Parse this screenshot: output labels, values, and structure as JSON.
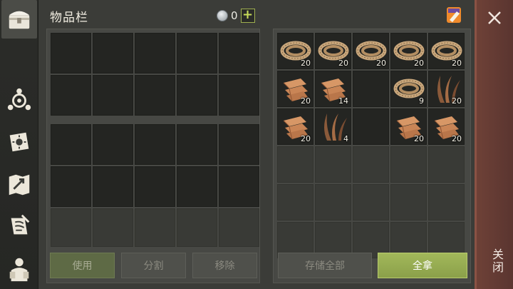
{
  "title": "物品栏",
  "currency": {
    "icon": "silver-coin-icon",
    "count": "0",
    "add_label": "+"
  },
  "sidebar": {
    "items": [
      {
        "name": "backpack",
        "icon": "chest-icon",
        "active": true
      },
      {
        "name": "crafting",
        "icon": "crafting-icon"
      },
      {
        "name": "journal",
        "icon": "sun-book-icon"
      },
      {
        "name": "map",
        "icon": "map-icon"
      },
      {
        "name": "quests",
        "icon": "scroll-icon"
      },
      {
        "name": "character",
        "icon": "character-icon"
      }
    ]
  },
  "left_actions": {
    "use": "使用",
    "split": "分割",
    "remove": "移除"
  },
  "right_actions": {
    "store_all": "存储全部",
    "take_all": "全拿"
  },
  "storage": {
    "rows": [
      [
        {
          "item": "rope",
          "qty": "20"
        },
        {
          "item": "rope",
          "qty": "20"
        },
        {
          "item": "rope",
          "qty": "20"
        },
        {
          "item": "rope",
          "qty": "20"
        },
        {
          "item": "rope",
          "qty": "20"
        }
      ],
      [
        {
          "item": "cloth",
          "qty": "20"
        },
        {
          "item": "cloth",
          "qty": "14"
        },
        null,
        {
          "item": "rope",
          "qty": "9"
        },
        {
          "item": "fiber",
          "qty": "20"
        }
      ],
      [
        {
          "item": "cloth",
          "qty": "20"
        },
        {
          "item": "fiber",
          "qty": "4"
        },
        null,
        {
          "item": "cloth",
          "qty": "20"
        },
        {
          "item": "cloth",
          "qty": "20"
        }
      ]
    ]
  },
  "close": {
    "label": "关闭"
  },
  "colors": {
    "accent_green": "#9fb04f",
    "close_bg": "#6e4137"
  }
}
